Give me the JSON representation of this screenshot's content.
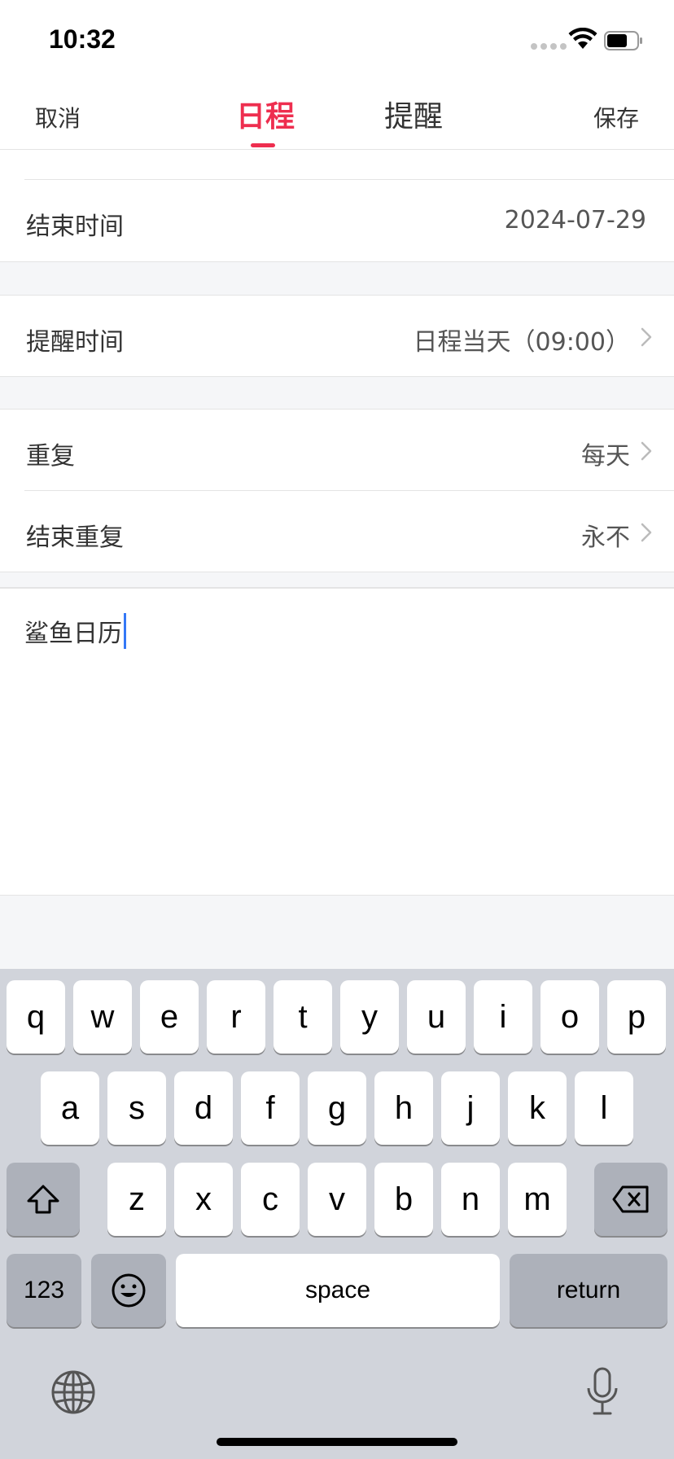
{
  "status_bar": {
    "time": "10:32"
  },
  "header": {
    "cancel": "取消",
    "save": "保存",
    "tabs": [
      {
        "label": "日程",
        "active": true
      },
      {
        "label": "提醒",
        "active": false
      }
    ],
    "accent_color": "#ee2e4f"
  },
  "form": {
    "end_time": {
      "label": "结束时间",
      "value": "2024-07-29"
    },
    "reminder_time": {
      "label": "提醒时间",
      "value": "日程当天（09:00）"
    },
    "repeat": {
      "label": "重复",
      "value": "每天"
    },
    "end_repeat": {
      "label": "结束重复",
      "value": "永不"
    }
  },
  "note": {
    "text": "鲨鱼日历"
  },
  "keyboard": {
    "row1": [
      "q",
      "w",
      "e",
      "r",
      "t",
      "y",
      "u",
      "i",
      "o",
      "p"
    ],
    "row2": [
      "a",
      "s",
      "d",
      "f",
      "g",
      "h",
      "j",
      "k",
      "l"
    ],
    "row3": [
      "z",
      "x",
      "c",
      "v",
      "b",
      "n",
      "m"
    ],
    "numbers_label": "123",
    "space_label": "space",
    "return_label": "return"
  }
}
